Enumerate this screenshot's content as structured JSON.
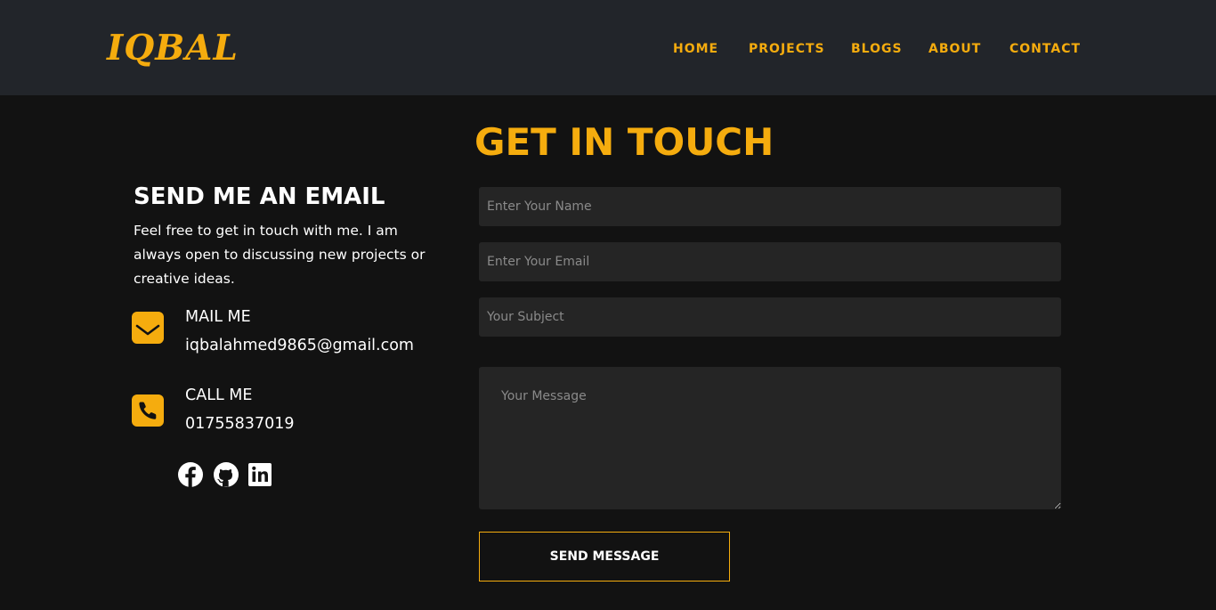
{
  "nav": {
    "logo": "IQBAL",
    "links": [
      "HOME",
      "PROJECTS",
      "BLOGS",
      "ABOUT",
      "CONTACT"
    ]
  },
  "contact": {
    "title": "GET IN TOUCH",
    "side_title": "SEND ME AN EMAIL",
    "side_desc": "Feel free to get in touch with me. I am always open to discussing new projects or creative ideas.",
    "mail_label": "MAIL ME",
    "mail_value": "iqbalahmed9865@gmail.com",
    "call_label": "CALL ME",
    "call_value": "01755837019",
    "social": [
      "facebook-icon",
      "github-icon",
      "linkedin-icon"
    ]
  },
  "form": {
    "name_placeholder": "Enter Your Name",
    "email_placeholder": "Enter Your Email",
    "subject_placeholder": "Your Subject",
    "message_placeholder": "Your Message",
    "name_value": "",
    "email_value": "",
    "subject_value": "",
    "message_value": "",
    "submit_label": "SEND MESSAGE"
  },
  "colors": {
    "accent": "#f5ac0e",
    "navbar_bg": "#22252a",
    "page_bg": "#121212",
    "field_bg": "#252525"
  }
}
